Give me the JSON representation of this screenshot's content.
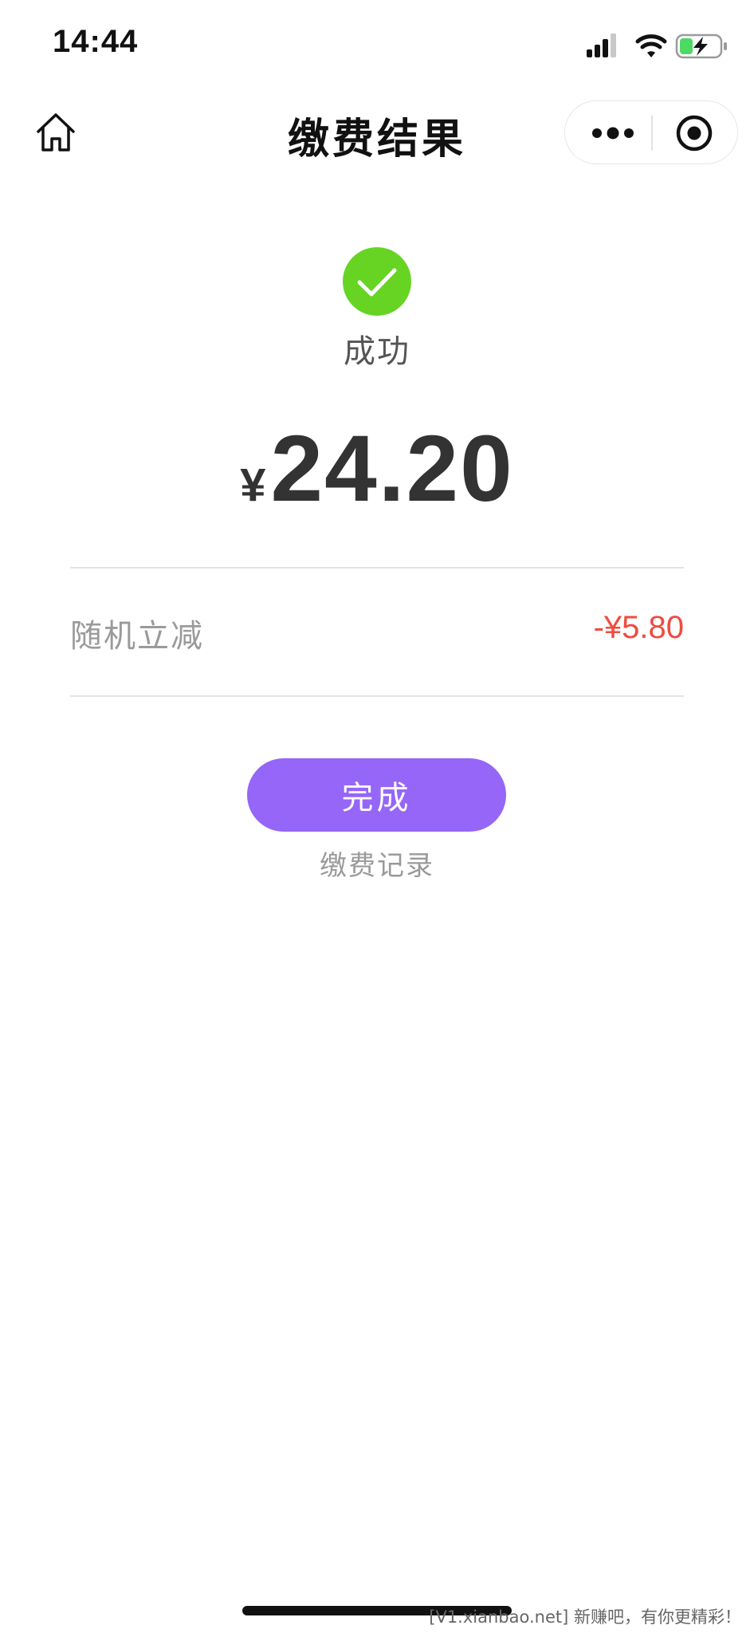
{
  "status_bar": {
    "time": "14:44",
    "icons": [
      "signal-icon",
      "wifi-icon",
      "battery-charging-icon"
    ],
    "battery_color": "#4cd964"
  },
  "nav": {
    "title": "缴费结果",
    "left_icon": "home-icon",
    "capsule_icons": [
      "more-icon",
      "target-icon"
    ]
  },
  "result": {
    "icon": "check-circle-icon",
    "icon_color": "#67d424",
    "status": "成功",
    "currency_symbol": "¥",
    "amount": "24.20"
  },
  "discount": {
    "label": "随机立减",
    "value": "-¥5.80",
    "value_color": "#f04b3e"
  },
  "actions": {
    "done_label": "完成",
    "done_color": "#9566f7",
    "records_label": "缴费记录"
  },
  "watermark": "[V1.xianbao.net] 新赚吧，有你更精彩！"
}
